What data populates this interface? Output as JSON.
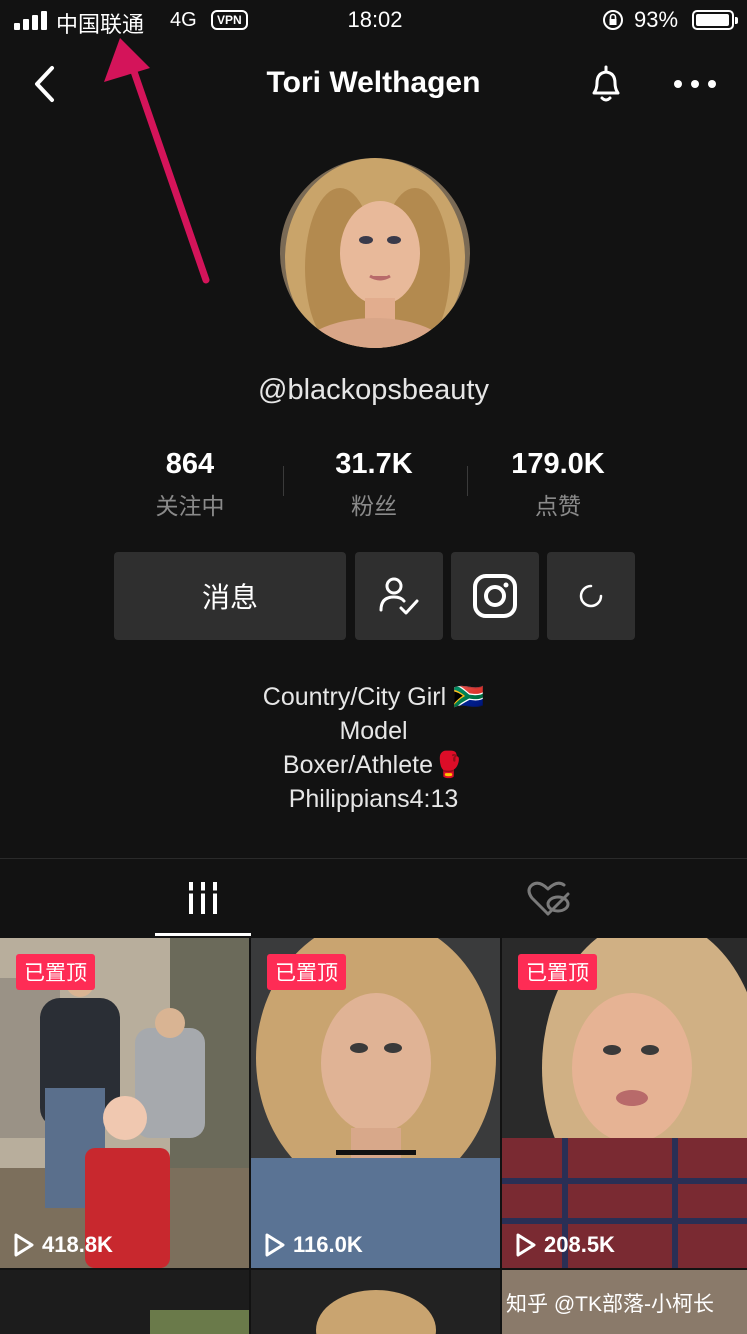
{
  "status_bar": {
    "carrier": "中国联通",
    "network": "4G",
    "vpn": "VPN",
    "time": "18:02",
    "battery_percent": "93%"
  },
  "nav": {
    "back_icon": "chevron-left-icon",
    "title": "Tori Welthagen",
    "bell_icon": "bell-icon",
    "more_icon": "more-horizontal-icon"
  },
  "profile": {
    "handle": "@blackopsbeauty",
    "stats": [
      {
        "value": "864",
        "label": "关注中"
      },
      {
        "value": "31.7K",
        "label": "粉丝"
      },
      {
        "value": "179.0K",
        "label": "点赞"
      }
    ],
    "message_button": "消息",
    "bio": [
      "Country/City Girl 🇿🇦",
      "Model",
      "Boxer/Athlete🥊",
      "Philippians4:13"
    ]
  },
  "videos": [
    {
      "pinned": "已置顶",
      "views": "418.8K"
    },
    {
      "pinned": "已置顶",
      "views": "116.0K"
    },
    {
      "pinned": "已置顶",
      "views": "208.5K"
    }
  ],
  "watermark": "知乎 @TK部落-小柯长",
  "colors": {
    "background": "#121212",
    "button": "#2f2f2f",
    "pinned_badge": "#fe2c55",
    "annotation_arrow": "#d4145a"
  }
}
